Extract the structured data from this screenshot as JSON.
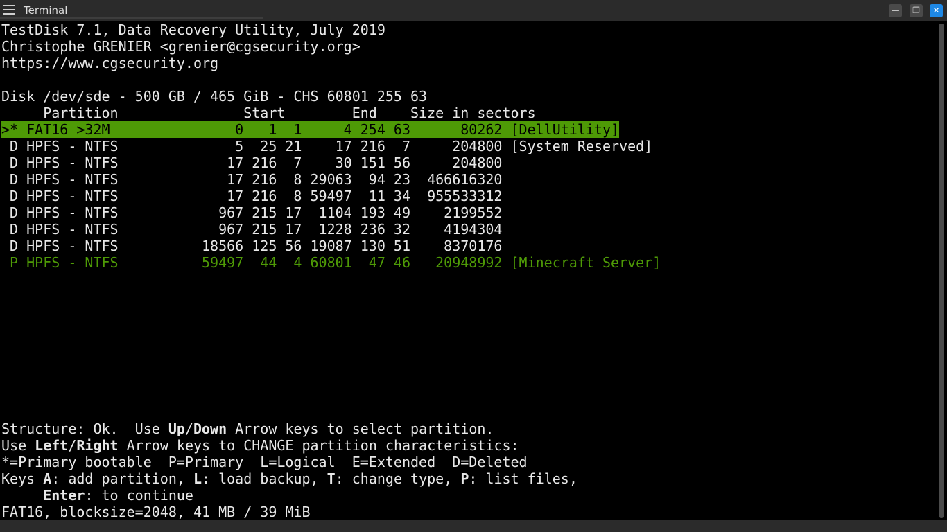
{
  "window": {
    "title": "Terminal"
  },
  "window_buttons": {
    "minimize": "—",
    "restore": "❐",
    "close": "✕"
  },
  "header": {
    "line1": "TestDisk 7.1, Data Recovery Utility, July 2019",
    "line2": "Christophe GRENIER <grenier@cgsecurity.org>",
    "line3": "https://www.cgsecurity.org"
  },
  "disk_info": "Disk /dev/sde - 500 GB / 465 GiB - CHS 60801 255 63",
  "table_header": "     Partition               Start        End    Size in sectors",
  "partitions": [
    ">* FAT16 >32M               0   1  1     4 254 63      80262 [DellUtility]",
    " D HPFS - NTFS              5  25 21    17 216  7     204800 [System Reserved]",
    " D HPFS - NTFS             17 216  7    30 151 56     204800",
    " D HPFS - NTFS             17 216  8 29063  94 23  466616320",
    " D HPFS - NTFS             17 216  8 59497  11 34  955533312",
    " D HPFS - NTFS            967 215 17  1104 193 49    2199552",
    " D HPFS - NTFS            967 215 17  1228 236 32    4194304",
    " D HPFS - NTFS          18566 125 56 19087 130 51    8370176",
    " P HPFS - NTFS          59497  44  4 60801  47 46   20948992 [Minecraft Server]"
  ],
  "footer": {
    "l1_a": "Structure: Ok.  Use ",
    "l1_b": "Up",
    "l1_c": "/",
    "l1_d": "Down",
    "l1_e": " Arrow keys to select partition.",
    "l2_a": "Use ",
    "l2_b": "Left",
    "l2_c": "/",
    "l2_d": "Right",
    "l2_e": " Arrow keys to CHANGE partition characteristics:",
    "l3": "*=Primary bootable  P=Primary  L=Logical  E=Extended  D=Deleted",
    "l4_a": "Keys ",
    "l4_b": "A",
    "l4_c": ": add partition, ",
    "l4_d": "L",
    "l4_e": ": load backup, ",
    "l4_f": "T",
    "l4_g": ": change type, ",
    "l4_h": "P",
    "l4_i": ": list files,",
    "l5_a": "     ",
    "l5_b": "Enter",
    "l5_c": ": to continue",
    "l6": "FAT16, blocksize=2048, 41 MB / 39 MiB"
  },
  "colors": {
    "highlight": "#4e9a06",
    "primary_partition": "#4e9a06",
    "close_button": "#1e88e5"
  }
}
